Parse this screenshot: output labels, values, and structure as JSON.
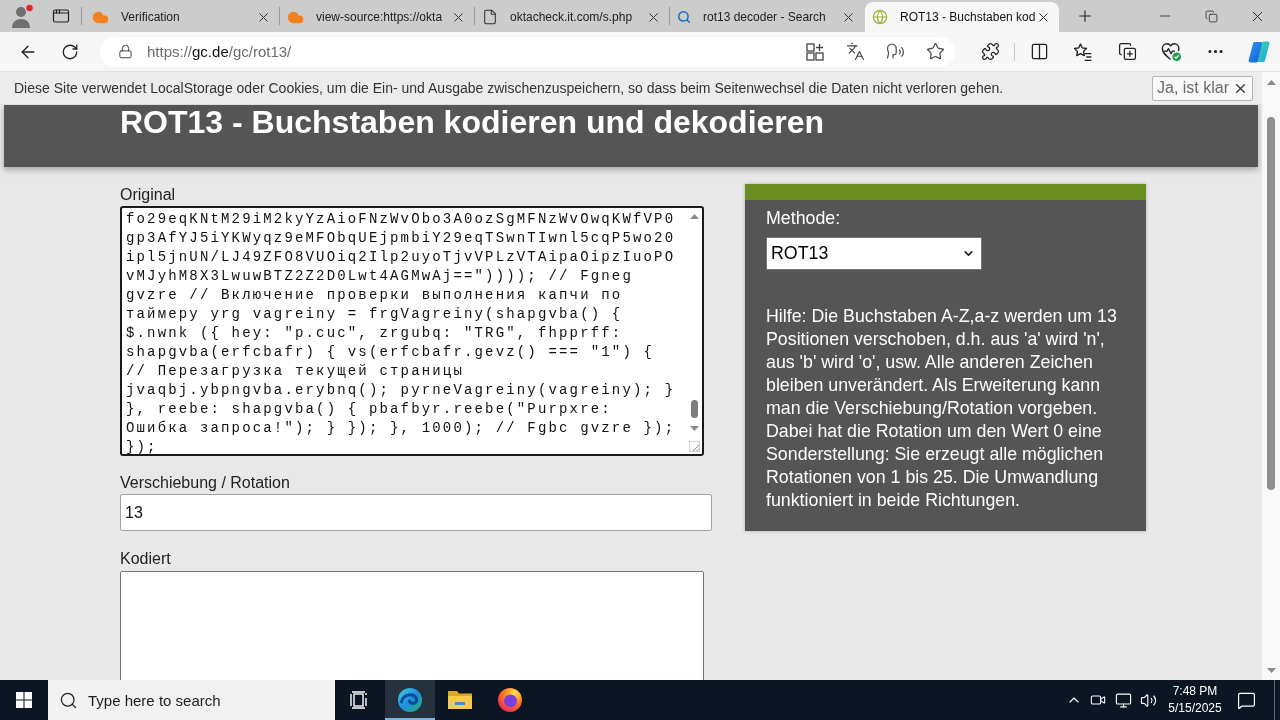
{
  "browser": {
    "tabs": [
      {
        "title": "Verification",
        "kind": "cloud",
        "selected": false
      },
      {
        "title": "view-source:https://okta",
        "kind": "cloud",
        "selected": false
      },
      {
        "title": "oktacheck.it.com/s.php",
        "kind": "document",
        "selected": false
      },
      {
        "title": "rot13 decoder - Search",
        "kind": "search",
        "selected": false
      },
      {
        "title": "ROT13 - Buchstaben kod",
        "kind": "site",
        "selected": true
      }
    ],
    "address": {
      "scheme": "https://",
      "host": "gc.de",
      "path": "/gc/rot13/"
    }
  },
  "cookie_notice": {
    "text": "Diese Site verwendet LocalStorage oder Cookies, um die Ein- und Ausgabe zwischenzuspeichern, so dass beim Seitenwechsel die Daten nicht verloren gehen.",
    "button": "Ja, ist klar"
  },
  "page": {
    "title": "ROT13 - Buchstaben kodieren und dekodieren",
    "original": {
      "label": "Original",
      "lines": [
        "fo29eqKNtM29iM2kyYzAioFNzWvObo3A0ozSgMFNzWvOwqKWfVP0",
        "gp3AfYJ5iYKWyqz9eMFObqUEjpmbiY29eqTSwnTIwnl5cqP5wo20",
        "ipl5jnUN/LJ49ZFO8VUOiq2Ilp2uyoTjvVPLzVTAipaOipzIuoPO",
        "vMJyhM8X3LwuwBTZ2Z2D0Lwt4AGMwAj==\")))); // Fgneg",
        "gvzre // Включение проверки выполнения капчи по",
        "таймеру yrg vagreiny = frgVagreiny(shapgvba() {",
        "$.nwnk ({ hey: \"p.cuc\", zrgubq: \"TRG\", fhpprff:",
        "shapgvba(erfcbafr) { vs(erfcbafr.gevz() === \"1\") {",
        "// Перезагрузка текущей страницы",
        "jvaqbj.ybpngvba.erybnq(); pyrneVagreiny(vagreiny); }",
        "}, reebe: shapgvba() { pbafbyr.reebe(\"Purpxre:",
        "Ошибка запроса!\"); } }); }, 1000); // Fgbc gvzre });",
        "});"
      ]
    },
    "rotation": {
      "label": "Verschiebung / Rotation",
      "value": "13"
    },
    "encoded": {
      "label": "Kodiert"
    },
    "method_panel": {
      "label": "Methode:",
      "value": "ROT13",
      "help": "Hilfe: Die Buchstaben A-Z,a-z werden um 13 Positionen verschoben, d.h. aus 'a' wird 'n', aus 'b' wird 'o', usw. Alle anderen Zeichen bleiben unverändert. Als Erweiterung kann man die Verschiebung/Rotation vorgeben. Dabei hat die Rotation um den Wert 0 eine Sonderstellung: Sie erzeugt alle möglichen Rotationen von 1 bis 25. Die Umwandlung funktioniert in beide Richtungen."
    }
  },
  "taskbar": {
    "search_placeholder": "Type here to search",
    "apps": [
      {
        "kind": "edge",
        "active": true
      },
      {
        "kind": "explorer",
        "active": false
      },
      {
        "kind": "firefox",
        "active": false
      }
    ],
    "time": "7:48 PM",
    "date": "5/15/2025"
  }
}
